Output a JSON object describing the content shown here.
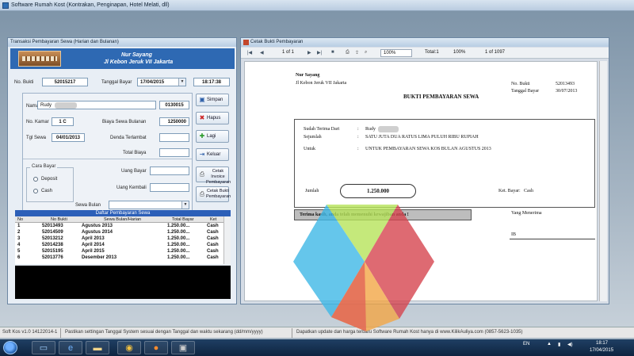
{
  "app": {
    "title": "Software Rumah Kost (Kontrakan, Penginapan, Hotel Melati, dll)",
    "status": {
      "version": "Soft Kos v1.0 14122014-1",
      "hint": "Pastikan settingan Tanggal System sesuai dengan Tanggal dan waktu sekarang (dd/mm/yyyy)",
      "promo": "Dapatkan update dan harga terbaru Software Rumah Kost hanya di www.KilikAuliya.com (0857-5623-1035)"
    }
  },
  "left_window": {
    "title": "Transaksi Pembayaran Sewa (Harian dan Bulanan)",
    "banner": {
      "name": "Nur Sayang",
      "address": "Jl Kebon Jeruk VII  Jakarta"
    },
    "no_bukti_label": "No. Bukti",
    "no_bukti": "52015217",
    "tanggal_bayar_label": "Tanggal Bayar",
    "tanggal_bayar": "17/04/2015",
    "jam": "18:17:38",
    "nama_label": "Nama",
    "nama": "Rudy",
    "nama_kode": "0130015",
    "no_kamar_label": "No. Kamar",
    "no_kamar": "1 C",
    "biaya_label": "Biaya Sewa Bulanan",
    "biaya": "1250000",
    "tgl_sewa_label": "Tgl Sewa",
    "tgl_sewa": "04/01/2013",
    "denda_label": "Denda Terlambat",
    "total_label": "Total Biaya",
    "cara_bayar_label": "Cara Bayar",
    "deposit_label": "Deposit",
    "cash_label": "Cash",
    "uang_bayar_label": "Uang Bayar",
    "uang_kembali_label": "Uang Kembali",
    "sewa_bulan_label": "Sewa Bulan",
    "buttons": {
      "simpan": "Simpan",
      "hapus": "Hapus",
      "lagi": "Lagi",
      "keluar": "Keluar",
      "cetak_invoice": "Cetak Invoice Pembayaran",
      "cetak_bukti": "Cetak Bukti Pembayaran"
    },
    "list": {
      "title": "Daftar Pembayaran Sewa",
      "columns": [
        "No",
        "No Bukti",
        "Sewa Bulan/Harian",
        "Total Bayar",
        "Ket"
      ],
      "rows": [
        [
          "1",
          "52013493",
          "Agustus 2013",
          "1.250.00...",
          "Cash"
        ],
        [
          "2",
          "52014509",
          "Agustus 2014",
          "1.250.00...",
          "Cash"
        ],
        [
          "3",
          "52013212",
          "April 2013",
          "1.250.00...",
          "Cash"
        ],
        [
          "4",
          "52014238",
          "April 2014",
          "1.250.00...",
          "Cash"
        ],
        [
          "5",
          "52015195",
          "April 2015",
          "1.250.00...",
          "Cash"
        ],
        [
          "6",
          "52013776",
          "Desember 2013",
          "1.250.00...",
          "Cash"
        ]
      ]
    }
  },
  "right_window": {
    "title": "Cetak Bukti Pembayaran",
    "toolbar": {
      "page": "1 of 1",
      "zoom": "100%",
      "total": "Total:1",
      "percent": "100%",
      "of": "1 of 1097"
    },
    "receipt": {
      "name": "Nur Sayang",
      "address": "Jl Kebon Jeruk VII  Jakarta",
      "no_label": "No. Bukti",
      "no": "52013493",
      "tgl_label": "Tanggal Bayar",
      "tgl": "30/07/2013",
      "heading": "BUKTI PEMBAYARAN SEWA",
      "dari_label": "Sudah Terima Dari",
      "dari": "Rudy",
      "sejumlah_label": "Sejumlah",
      "sejumlah": "SATU JUTA DUA RATUS LIMA PULUH RIBU RUPIAH",
      "untuk_label": "Untuk",
      "untuk": "UNTUK PEMBAYARAN SEWA KOS  BULAN AGUSTUS 2013",
      "jumlah_label": "Jumlah",
      "jumlah": "1.250.000",
      "ket_label": "Ket. Bayar",
      "ket": "Cash",
      "penerima_label": "Yang Menerima",
      "penerima": "IB",
      "thanks": "Terima kasih, anda telah memenuhi kewajiban anda !"
    }
  },
  "taskbar": {
    "lang": "EN",
    "time": "18:17",
    "date": "17/04/2015"
  },
  "colors": {
    "banner": "#2e69b3",
    "list_header": "#2c5fb8",
    "taskbar": "#1f3f63"
  }
}
